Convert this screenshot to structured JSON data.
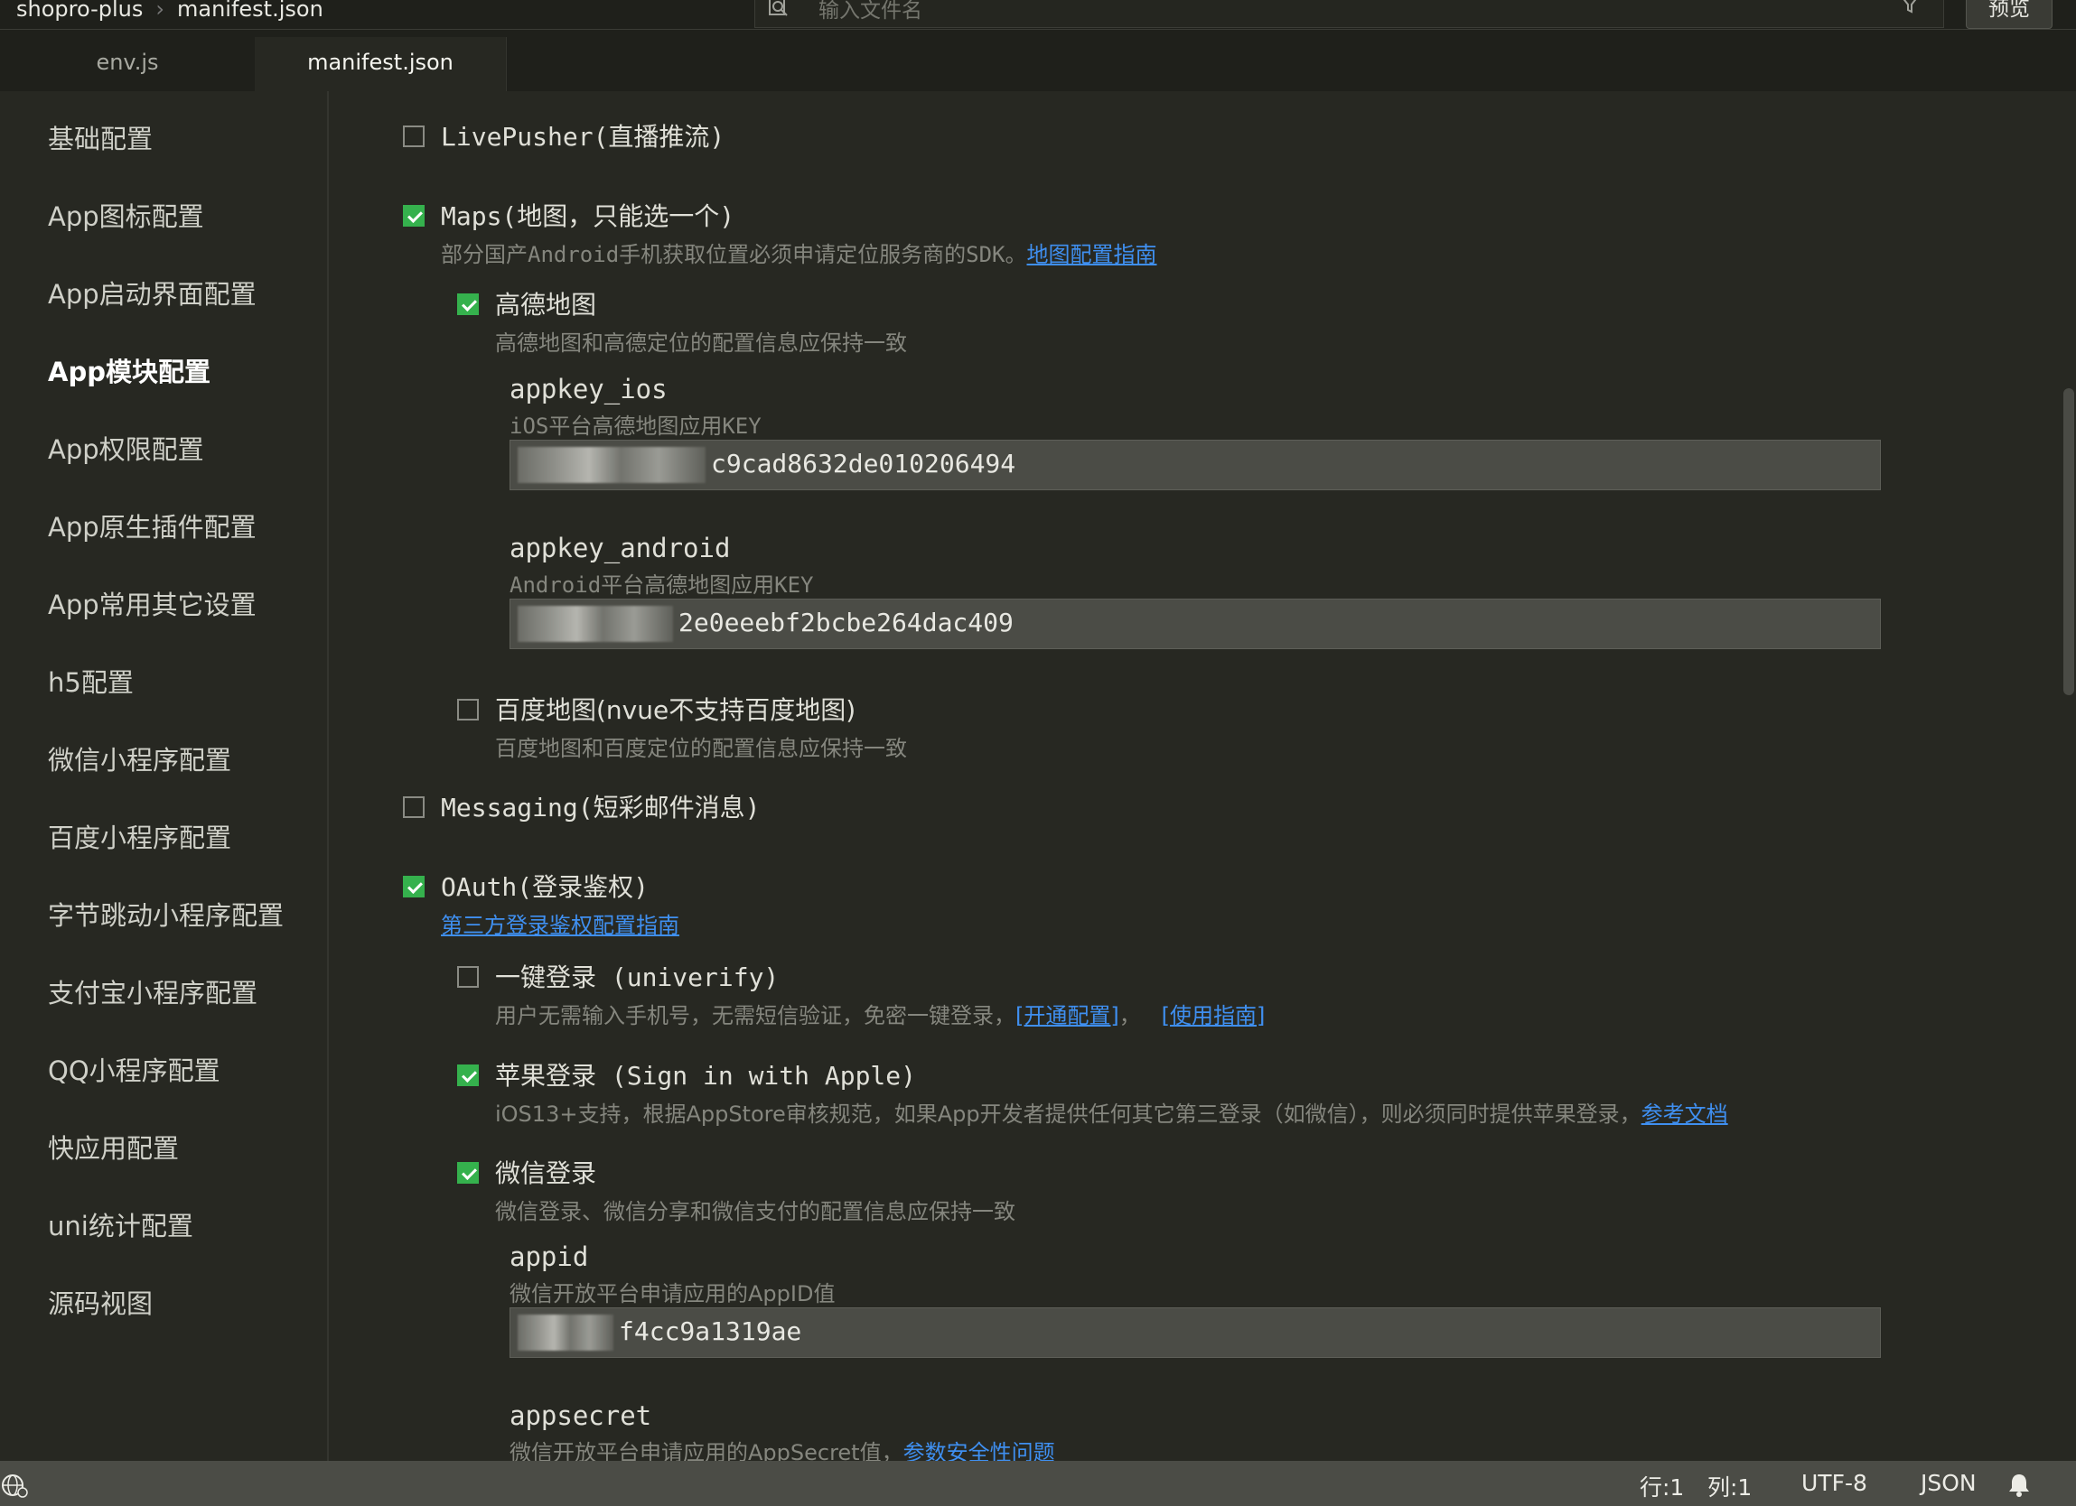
{
  "topbar": {
    "breadcrumb_project": "shopro-plus",
    "breadcrumb_file": "manifest.json",
    "search_placeholder": "输入文件名",
    "preview_label": "预览"
  },
  "tabs": [
    {
      "label": "env.js"
    },
    {
      "label": "manifest.json"
    }
  ],
  "sidebar": {
    "items": [
      {
        "label": "基础配置"
      },
      {
        "label": "App图标配置"
      },
      {
        "label": "App启动界面配置"
      },
      {
        "label": "App模块配置"
      },
      {
        "label": "App权限配置"
      },
      {
        "label": "App原生插件配置"
      },
      {
        "label": "App常用其它设置"
      },
      {
        "label": "h5配置"
      },
      {
        "label": "微信小程序配置"
      },
      {
        "label": "百度小程序配置"
      },
      {
        "label": "字节跳动小程序配置"
      },
      {
        "label": "支付宝小程序配置"
      },
      {
        "label": "QQ小程序配置"
      },
      {
        "label": "快应用配置"
      },
      {
        "label": "uni统计配置"
      },
      {
        "label": "源码视图"
      }
    ],
    "active": "App模块配置"
  },
  "content": {
    "livepusher": {
      "label": "LivePusher(直播推流)",
      "checked": false
    },
    "maps": {
      "label": "Maps(地图，只能选一个)",
      "checked": true,
      "desc": "部分国产Android手机获取位置必须申请定位服务商的SDK。",
      "link": "地图配置指南"
    },
    "amap": {
      "label": "高德地图",
      "checked": true,
      "desc": "高德地图和高德定位的配置信息应保持一致",
      "appkey_ios": {
        "name": "appkey_ios",
        "desc": "iOS平台高德地图应用KEY",
        "value": "c9cad8632de010206494"
      },
      "appkey_android": {
        "name": "appkey_android",
        "desc": "Android平台高德地图应用KEY",
        "value": "2e0eeebf2bcbe264dac409"
      }
    },
    "baidumap": {
      "label": "百度地图(nvue不支持百度地图)",
      "checked": false,
      "desc": "百度地图和百度定位的配置信息应保持一致"
    },
    "messaging": {
      "label": "Messaging(短彩邮件消息)",
      "checked": false
    },
    "oauth": {
      "label": "OAuth(登录鉴权)",
      "checked": true,
      "link": "第三方登录鉴权配置指南"
    },
    "univerify": {
      "label": "一键登录 (univerify)",
      "checked": false,
      "desc": "用户无需输入手机号，无需短信验证，免密一键登录，",
      "link1": "[开通配置]",
      "sep": "，",
      "link2": "[使用指南]"
    },
    "apple": {
      "label": "苹果登录 (Sign in with Apple)",
      "checked": true,
      "desc": "iOS13+支持，根据AppStore审核规范，如果App开发者提供任何其它第三登录（如微信），则必须同时提供苹果登录，",
      "link": "参考文档"
    },
    "wechat": {
      "label": "微信登录",
      "checked": true,
      "desc": "微信登录、微信分享和微信支付的配置信息应保持一致",
      "appid": {
        "name": "appid",
        "desc": "微信开放平台申请应用的AppID值",
        "value": "f4cc9a1319ae"
      },
      "appsecret": {
        "name": "appsecret",
        "desc": "微信开放平台申请应用的AppSecret值，",
        "link": "参数安全性问题"
      }
    }
  },
  "statusbar": {
    "line": "行:1",
    "col": "列:1",
    "encoding": "UTF-8",
    "language": "JSON"
  },
  "colors": {
    "background": "#272822",
    "accent_green": "#35b14d",
    "link_blue": "#3f8ff0",
    "statusbar": "#4b4c46"
  }
}
